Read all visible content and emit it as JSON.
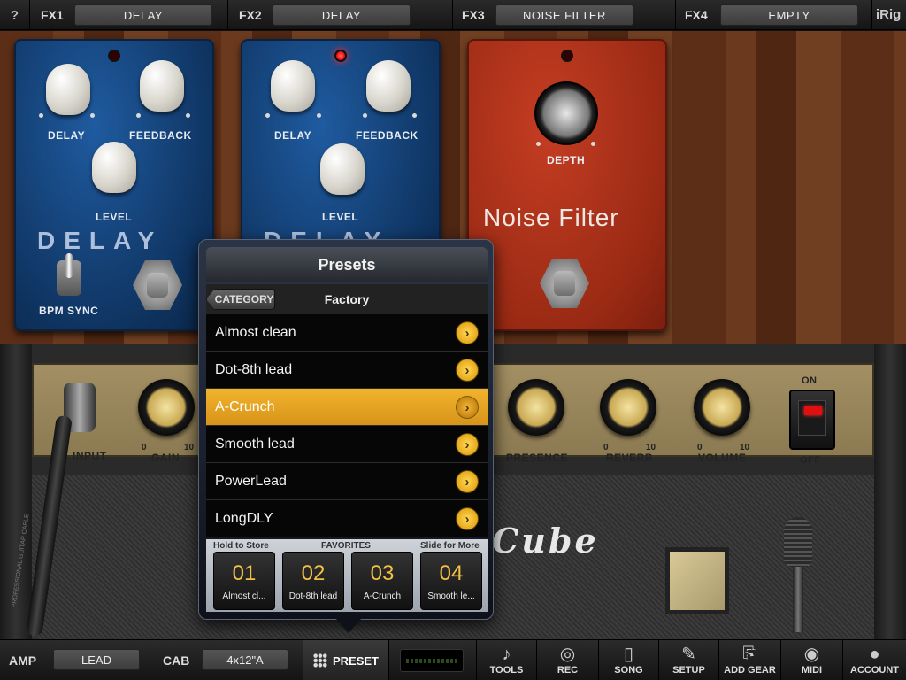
{
  "topbar": {
    "help": "?",
    "slots": [
      {
        "label": "FX1",
        "value": "DELAY"
      },
      {
        "label": "FX2",
        "value": "DELAY"
      },
      {
        "label": "FX3",
        "value": "NOISE FILTER"
      },
      {
        "label": "FX4",
        "value": "EMPTY"
      }
    ],
    "brand": "iRig"
  },
  "pedals": {
    "delay1": {
      "delay": "DELAY",
      "feedback": "FEEDBACK",
      "level": "LEVEL",
      "name": "DELAY",
      "toggle": "BPM SYNC"
    },
    "delay2": {
      "delay": "DELAY",
      "feedback": "FEEDBACK",
      "level": "LEVEL",
      "name": "DELAY"
    },
    "noise": {
      "depth": "DEPTH",
      "name": "Noise Filter"
    }
  },
  "amp": {
    "input": "INPUT",
    "gain": "GAIN",
    "presence": "PRESENCE",
    "reverb": "REVERB",
    "volume": "VOLUME",
    "tick_min": "0",
    "tick_max": "10",
    "power_on": "ON",
    "power_off": "OFF",
    "brand": "Cube",
    "cable_text": "PROFESSIONAL GUITAR CABLE"
  },
  "presets": {
    "title": "Presets",
    "category_button": "CATEGORY",
    "category": "Factory",
    "items": [
      {
        "name": "Almost clean"
      },
      {
        "name": "Dot-8th lead"
      },
      {
        "name": "A-Crunch"
      },
      {
        "name": "Smooth lead"
      },
      {
        "name": "PowerLead"
      },
      {
        "name": "LongDLY"
      }
    ],
    "selected_index": 2,
    "favorites_header": {
      "left": "Hold to Store",
      "center": "FAVORITES",
      "right": "Slide for More"
    },
    "favorites": [
      {
        "num": "01",
        "name": "Almost cl..."
      },
      {
        "num": "02",
        "name": "Dot-8th lead"
      },
      {
        "num": "03",
        "name": "A-Crunch"
      },
      {
        "num": "04",
        "name": "Smooth le..."
      }
    ]
  },
  "bottombar": {
    "amp_label": "AMP",
    "amp_value": "LEAD",
    "cab_label": "CAB",
    "cab_value": "4x12\"A",
    "preset": "PRESET",
    "tools": [
      {
        "icon": "guitar-icon",
        "glyph": "♪",
        "label": "TOOLS"
      },
      {
        "icon": "tape-icon",
        "glyph": "◎",
        "label": "REC"
      },
      {
        "icon": "ipod-icon",
        "glyph": "▯",
        "label": "SONG"
      },
      {
        "icon": "wrench-icon",
        "glyph": "✎",
        "label": "SETUP"
      },
      {
        "icon": "add-gear-icon",
        "glyph": "⎘",
        "label": "ADD GEAR"
      },
      {
        "icon": "midi-icon",
        "glyph": "◉",
        "label": "MIDI"
      },
      {
        "icon": "account-icon",
        "glyph": "●",
        "label": "ACCOUNT"
      }
    ]
  }
}
